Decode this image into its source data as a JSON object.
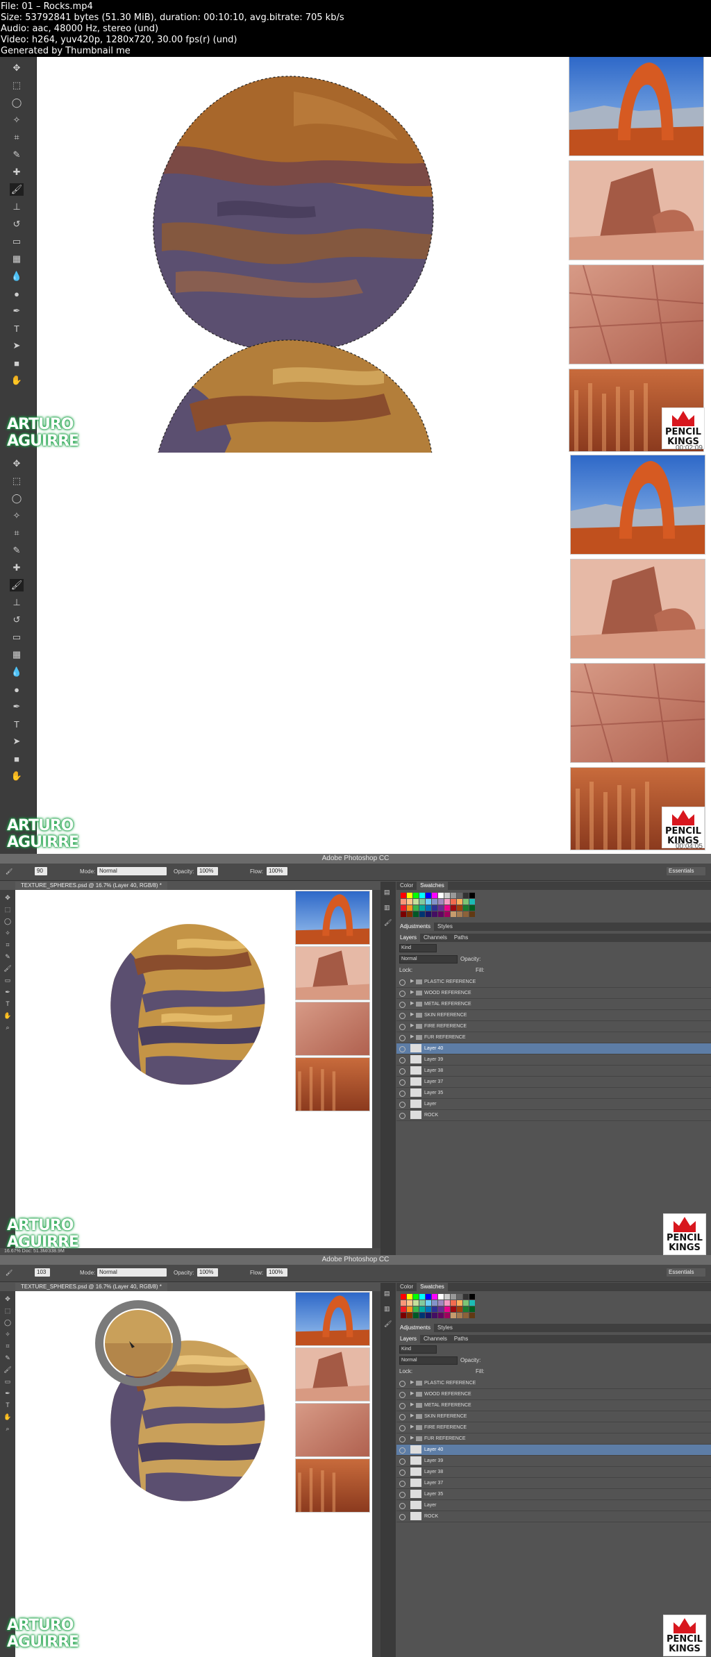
{
  "info": {
    "line1": "File: 01 – Rocks.mp4",
    "line2": "Size: 53792841 bytes (51.30 MiB), duration: 00:10:10, avg.bitrate: 705 kb/s",
    "line3": "Audio: aac, 48000 Hz, stereo (und)",
    "line4": "Video: h264, yuv420p, 1280x720, 30.00 fps(r) (und)",
    "line5": "Generated by Thumbnail me"
  },
  "brand": {
    "line1": "ARTURO",
    "line2": "AGUIRRE"
  },
  "pencil_kings": {
    "line1": "PENCIL",
    "line2": "KINGS"
  },
  "timestamps": {
    "f1": "00:02:09",
    "f2": "00:04:05"
  },
  "app": {
    "title": "Adobe Photoshop CC",
    "workspace": "Essentials",
    "document_tab": "TEXTURE_SPHERES.psd @ 16.7% (Layer 40, RGB/8) *",
    "brush_size_f3": "90",
    "brush_size_f4": "103",
    "mode_label": "Mode:",
    "mode_value": "Normal",
    "opacity_label": "Opacity:",
    "opacity_value": "100%",
    "flow_label": "Flow:",
    "flow_value": "100%",
    "status_text": "16.67%    Doc: 51.3M/338.9M"
  },
  "panels": {
    "color_tab": "Color",
    "swatches_tab": "Swatches",
    "adjustments_tab": "Adjustments",
    "styles_tab": "Styles",
    "layers_tab": "Layers",
    "channels_tab": "Channels",
    "paths_tab": "Paths",
    "kind_label": "Kind",
    "blend_mode": "Normal",
    "opacity_label": "Opacity:",
    "lock_label": "Lock:",
    "fill_label": "Fill:"
  },
  "layers": [
    {
      "name": "PLASTIC REFERENCE",
      "type": "group"
    },
    {
      "name": "WOOD REFERENCE",
      "type": "group"
    },
    {
      "name": "METAL REFERENCE",
      "type": "group"
    },
    {
      "name": "SKIN REFERENCE",
      "type": "group"
    },
    {
      "name": "FIRE REFERENCE",
      "type": "group"
    },
    {
      "name": "FUR REFERENCE",
      "type": "group"
    },
    {
      "name": "Layer 40",
      "type": "layer",
      "selected": true
    },
    {
      "name": "Layer 39",
      "type": "layer"
    },
    {
      "name": "Layer 38",
      "type": "layer"
    },
    {
      "name": "Layer 37",
      "type": "layer"
    },
    {
      "name": "Layer 35",
      "type": "layer"
    },
    {
      "name": "Layer",
      "type": "layer"
    },
    {
      "name": "ROCK",
      "type": "layer"
    }
  ],
  "colors": {
    "rock_orange": "#a86a2a",
    "rock_gold": "#c7963f",
    "rock_purple": "#5b4f70",
    "rock_dark": "#3f3551",
    "brand_green": "#1fa34a",
    "ps_gray": "#535353"
  }
}
